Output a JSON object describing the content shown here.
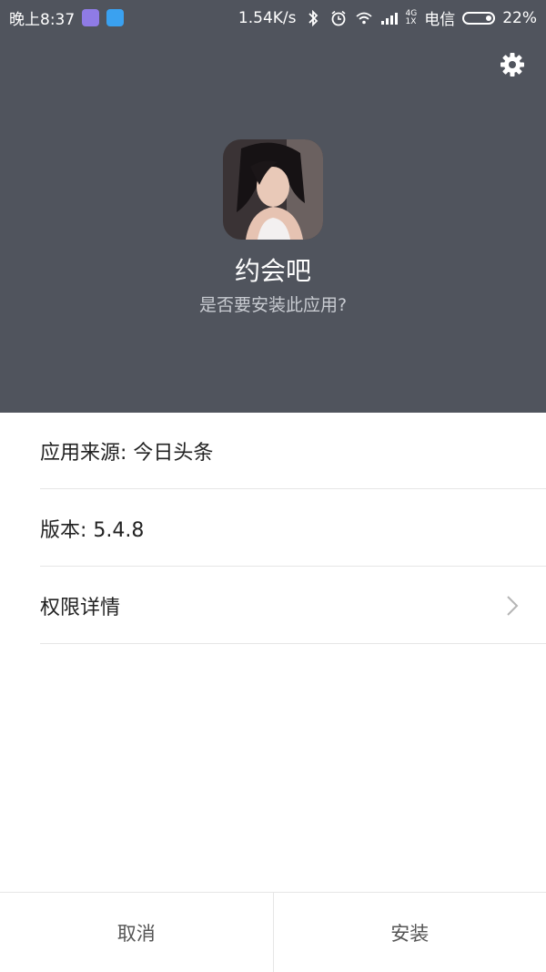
{
  "status_bar": {
    "time": "晚上8:37",
    "speed": "1.54K/s",
    "network_top": "4G",
    "network_bottom": "1X",
    "carrier": "电信",
    "battery": "22%",
    "battery_level": 0.22
  },
  "header": {
    "app_name": "约会吧",
    "question": "是否要安装此应用?"
  },
  "info": {
    "source": "应用来源: 今日头条",
    "version": "版本: 5.4.8",
    "permissions": "权限详情"
  },
  "buttons": {
    "cancel": "取消",
    "install": "安装"
  },
  "colors": {
    "header_bg": "#50545d",
    "divider": "#e6e6e6"
  }
}
